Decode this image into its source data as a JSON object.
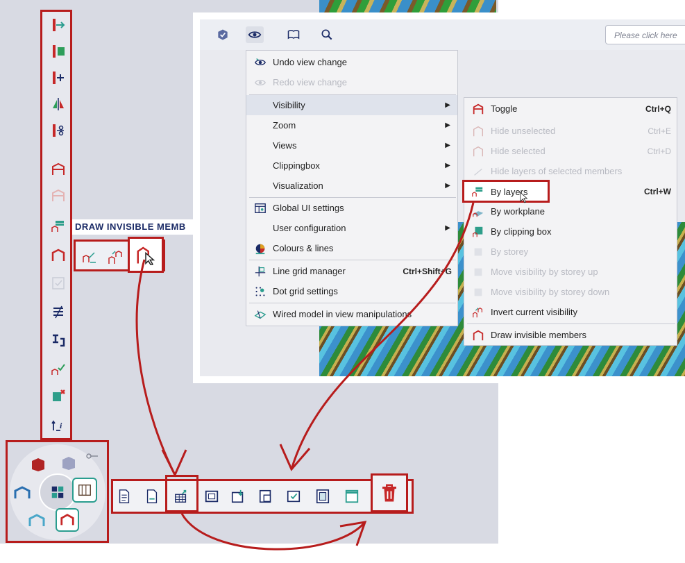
{
  "tooltip": {
    "text": "DRAW INVISIBLE MEMB"
  },
  "search": {
    "placeholder": "Please click here"
  },
  "menu": {
    "items": [
      {
        "label": "Undo view change",
        "shortcut": "",
        "submenu": false,
        "disabled": false,
        "icon": "undo-view-icon"
      },
      {
        "label": "Redo view change",
        "shortcut": "",
        "submenu": false,
        "disabled": true,
        "icon": "redo-view-icon"
      },
      {
        "label": "Visibility",
        "shortcut": "",
        "submenu": true,
        "disabled": false,
        "icon": ""
      },
      {
        "label": "Zoom",
        "shortcut": "",
        "submenu": true,
        "disabled": false,
        "icon": ""
      },
      {
        "label": "Views",
        "shortcut": "",
        "submenu": true,
        "disabled": false,
        "icon": ""
      },
      {
        "label": "Clippingbox",
        "shortcut": "",
        "submenu": true,
        "disabled": false,
        "icon": ""
      },
      {
        "label": "Visualization",
        "shortcut": "",
        "submenu": true,
        "disabled": false,
        "icon": ""
      },
      {
        "label": "Global UI settings",
        "shortcut": "",
        "submenu": false,
        "disabled": false,
        "icon": "global-settings-icon"
      },
      {
        "label": "User configuration",
        "shortcut": "",
        "submenu": true,
        "disabled": false,
        "icon": ""
      },
      {
        "label": "Colours & lines",
        "shortcut": "",
        "submenu": false,
        "disabled": false,
        "icon": "colours-icon"
      },
      {
        "label": "Line grid manager",
        "shortcut": "Ctrl+Shift+G",
        "submenu": false,
        "disabled": false,
        "icon": "line-grid-icon"
      },
      {
        "label": "Dot grid settings",
        "shortcut": "",
        "submenu": false,
        "disabled": false,
        "icon": "dot-grid-icon"
      },
      {
        "label": "Wired model in view manipulations",
        "shortcut": "",
        "submenu": false,
        "disabled": false,
        "icon": "wired-model-icon"
      }
    ]
  },
  "submenu": {
    "items": [
      {
        "label": "Toggle",
        "shortcut": "Ctrl+Q",
        "disabled": false
      },
      {
        "label": "Hide unselected",
        "shortcut": "Ctrl+E",
        "disabled": true
      },
      {
        "label": "Hide selected",
        "shortcut": "Ctrl+D",
        "disabled": true
      },
      {
        "label": "Hide layers of selected members",
        "shortcut": "",
        "disabled": true
      },
      {
        "label": "By layers",
        "shortcut": "Ctrl+W",
        "disabled": false
      },
      {
        "label": "By workplane",
        "shortcut": "",
        "disabled": false
      },
      {
        "label": "By clipping box",
        "shortcut": "",
        "disabled": false
      },
      {
        "label": "By storey",
        "shortcut": "",
        "disabled": true
      },
      {
        "label": "Move visibility by storey up",
        "shortcut": "",
        "disabled": true
      },
      {
        "label": "Move visibility by storey down",
        "shortcut": "",
        "disabled": true
      },
      {
        "label": "Invert current visibility",
        "shortcut": "",
        "disabled": false
      },
      {
        "label": "Draw invisible members",
        "shortcut": "",
        "disabled": false
      }
    ]
  },
  "colors": {
    "highlight_red": "#b71c1c",
    "accent_blue": "#1a2a66",
    "member_red": "#c62828"
  }
}
